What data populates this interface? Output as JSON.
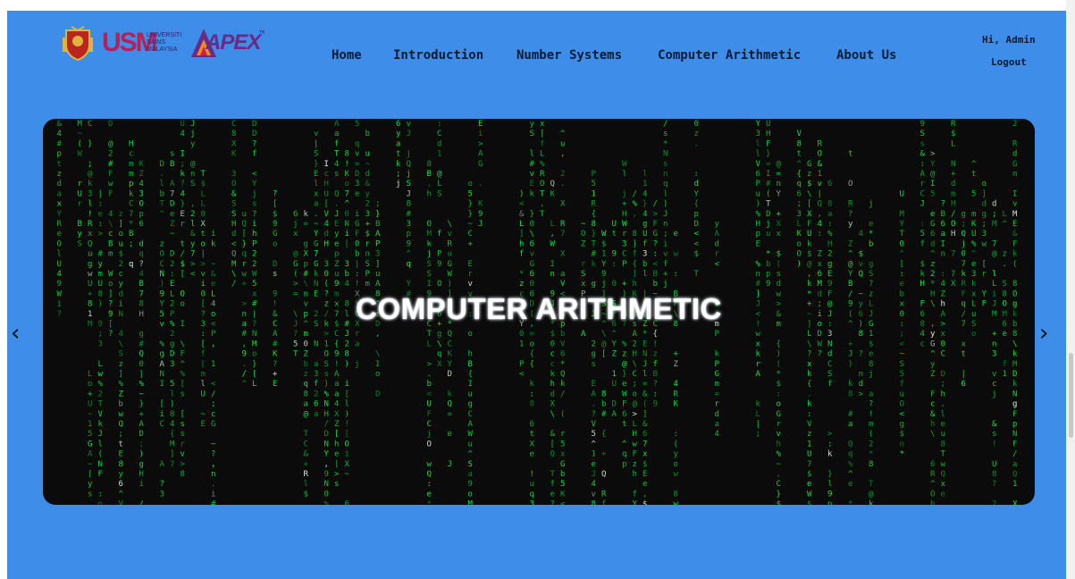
{
  "logos": {
    "usm_big": "USM",
    "usm_small": [
      "UNIVERSITI",
      "SAINS",
      "MALAYSIA"
    ],
    "apex": "APEX",
    "apex_tm": "TM"
  },
  "nav": {
    "items": [
      "Home",
      "Introduction",
      "Number Systems",
      "Computer Arithmetic",
      "About Us"
    ]
  },
  "user": {
    "greeting": "Hi, Admin",
    "logout": "Logout"
  },
  "carousel": {
    "title": "COMPUTER ARITHMETIC",
    "prev_symbol": "‹",
    "next_symbol": "›"
  },
  "colors": {
    "page_background": "#3d8de9",
    "matrix_green": "#00ff41",
    "carousel_background": "#0b0b0b"
  }
}
